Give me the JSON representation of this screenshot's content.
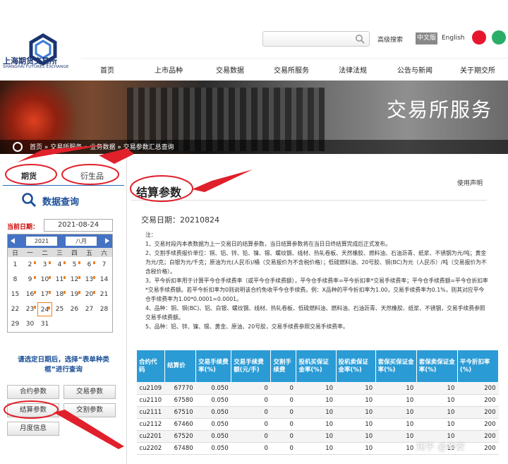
{
  "header": {
    "logo_cn": "上海期货交易所",
    "logo_en": "SHANGHAI FUTURES EXCHANGE",
    "search_placeholder": "",
    "advanced_search": "高级搜索",
    "lang_cn": "中文版",
    "lang_en": "English",
    "icons": [
      "weibo-icon",
      "wechat-icon"
    ]
  },
  "nav": [
    "首页",
    "上市品种",
    "交易数据",
    "交易所服务",
    "法律法规",
    "公告与新闻",
    "关于期交所"
  ],
  "banner": {
    "title": "交易所服务"
  },
  "breadcrumb": "首页 » 交易所服务 » 业务数据 » 交易参数汇总查询",
  "left": {
    "tabs": [
      "期货",
      "衍生品"
    ],
    "query_title": "数据查询",
    "current_date_label": "当前日期：",
    "current_date": "2021-08-24",
    "calendar": {
      "year": "2021",
      "month": "八月",
      "weekdays": [
        "日",
        "一",
        "二",
        "三",
        "四",
        "五",
        "六"
      ],
      "weeks": [
        [
          "1",
          "2",
          "3",
          "4",
          "5",
          "6",
          "7"
        ],
        [
          "8",
          "9",
          "10",
          "11",
          "12",
          "13",
          "14"
        ],
        [
          "15",
          "16",
          "17",
          "18",
          "19",
          "20",
          "21"
        ],
        [
          "22",
          "23",
          "24",
          "25",
          "26",
          "27",
          "28"
        ],
        [
          "29",
          "30",
          "31",
          "",
          "",
          "",
          ""
        ]
      ],
      "marked_days": [
        "2",
        "3",
        "4",
        "5",
        "6",
        "9",
        "10",
        "11",
        "12",
        "13",
        "16",
        "17",
        "18",
        "19",
        "20",
        "23",
        "24"
      ],
      "today": "24"
    },
    "hint": "请选定日期后，选择“表单种类框”进行查询",
    "buttons": [
      "合约参数",
      "交易参数",
      "结算参数",
      "交割参数",
      "月度信息"
    ]
  },
  "main": {
    "title": "结算参数",
    "disclaimer": "使用声明",
    "trade_date": "交易日期：20210824",
    "notes": [
      "注：",
      "1、交易时段内本表数据为上一交易日的结算参数，当日结算参数将在当日日终结算完成后正式发布。",
      "2、交割手续费报价单位：铜、铝、锌、铅、镍、锡、螺纹钢、线材、热轧卷板、天然橡胶、燃料油、石油沥青、纸浆、不锈钢为元/吨；黄金为元/克；白银为元/千克；原油为元(人民币)/桶（交易报价为不含税价格）；低硫燃料油、20号胶、铜(BC)为元（人民币）/吨（交易报价为不含税价格）。",
      "3、平今折扣率用于计算平今仓手续费率（或平今仓手续费额），平今仓手续费率=平今折扣率*交易手续费率；平今仓手续费额=平今仓折扣率*交易手续费额。若平今折扣率为0则说明该合约免收平今仓手续费。例：X品种的平今折扣率为1.00，交易手续费率为0.1%，则其对应平今仓手续费率为1.00*0.0001=0.0001。",
      "4、品种：铜、铜(BC)、铝、白银、螺纹钢、线材、热轧卷板、低硫燃料油、燃料油、石油沥青、天然橡胶、纸浆、不锈钢，交易手续费参照交易手续费额。",
      "5、品种：铝、锌、镍、锡、黄金、原油、20号胶，交易手续费参照交易手续费率。"
    ],
    "table": {
      "headers": [
        "合约代码",
        "结算价",
        "交易手续费率(%)",
        "交易手续费额(元/手)",
        "交割手续费",
        "投机买保证金率(%)",
        "投机卖保证金率(%)",
        "套保买保证金率(%)",
        "套保卖保证金率(%)",
        "平今折扣率(%)"
      ],
      "rows": [
        [
          "cu2109",
          "67770",
          "0.050",
          "0",
          "0",
          "10",
          "10",
          "10",
          "10",
          "200"
        ],
        [
          "cu2110",
          "67580",
          "0.050",
          "0",
          "0",
          "10",
          "10",
          "10",
          "10",
          "200"
        ],
        [
          "cu2111",
          "67510",
          "0.050",
          "0",
          "0",
          "10",
          "10",
          "10",
          "10",
          "200"
        ],
        [
          "cu2112",
          "67460",
          "0.050",
          "0",
          "0",
          "10",
          "10",
          "10",
          "10",
          "200"
        ],
        [
          "cu2201",
          "67520",
          "0.050",
          "0",
          "0",
          "10",
          "10",
          "10",
          "10",
          "200"
        ],
        [
          "cu2202",
          "67480",
          "0.050",
          "0",
          "0",
          "10",
          "10",
          "10",
          "10",
          "200"
        ]
      ]
    }
  },
  "watermark": "知乎 @华安",
  "colors": {
    "accent": "#2a9bd5",
    "annotation": "#e0202a",
    "nav_blue": "#1a4f98",
    "cal_head": "#4472c4"
  }
}
